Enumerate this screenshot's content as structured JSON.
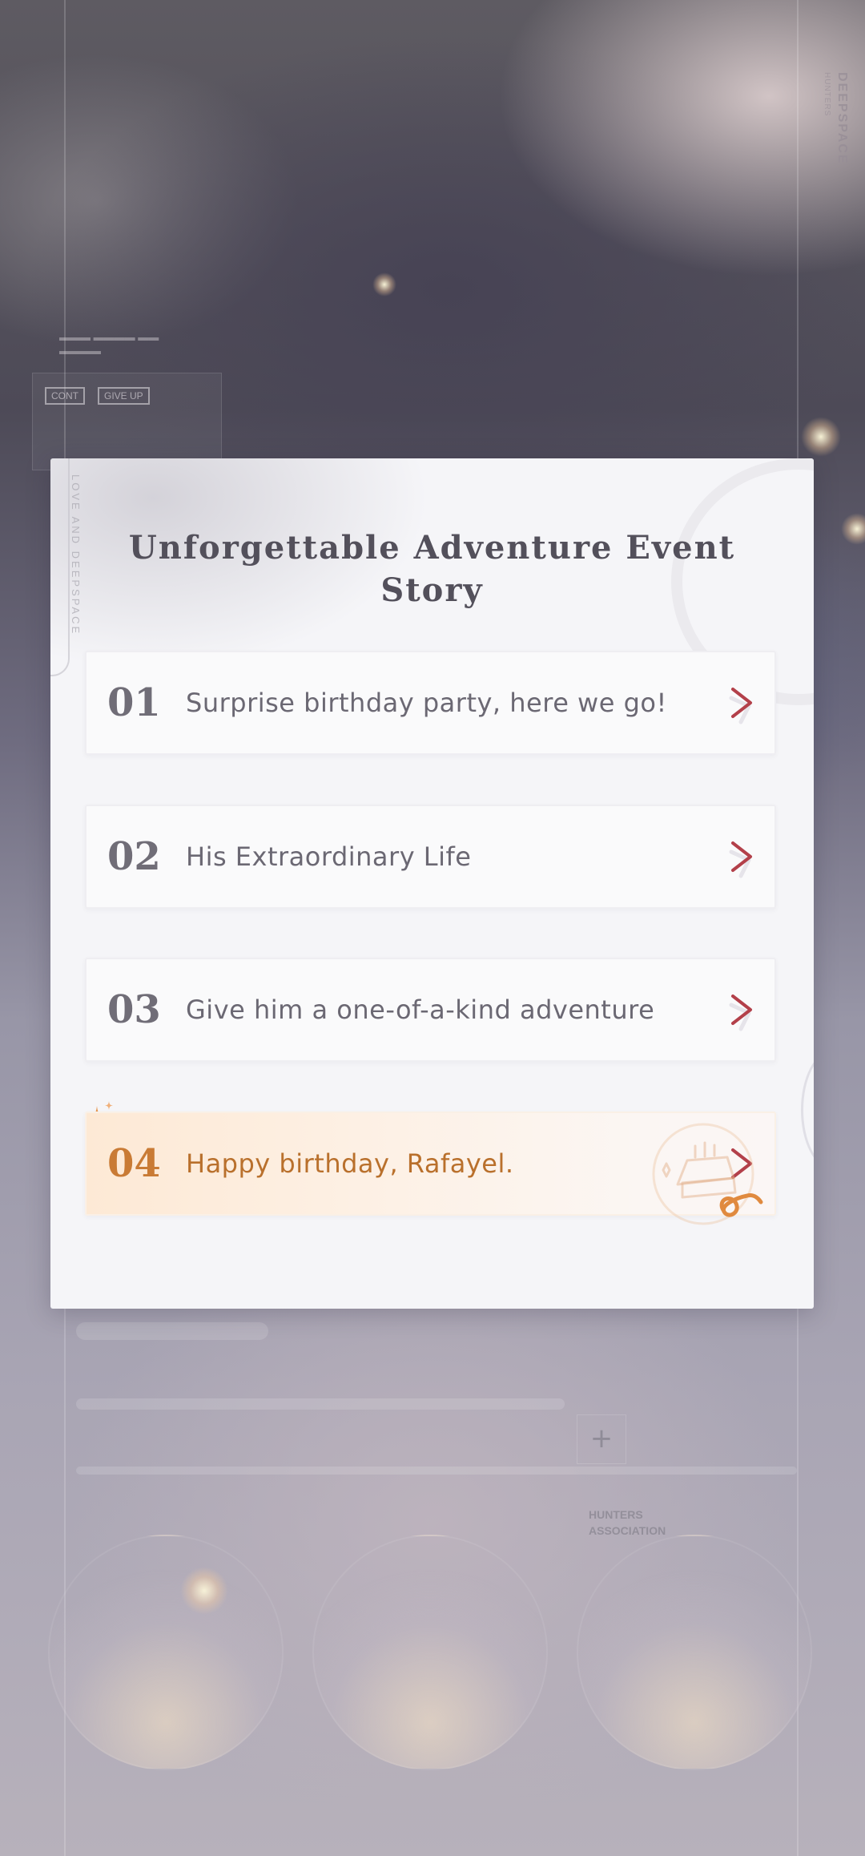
{
  "background": {
    "brand_vertical": "DEEPSPACE",
    "brand_sub": "HUNTERS",
    "ghost_buttons": [
      "CONT",
      "GIVE UP"
    ],
    "association": "HUNTERS\nASSOCIATION"
  },
  "modal": {
    "side_tag": "LOVE AND DEEPSPACE",
    "title": "Unforgettable Adventure Event Story",
    "episodes": [
      {
        "number": "01",
        "label": "Surprise birthday party, here we go!",
        "style": "normal"
      },
      {
        "number": "02",
        "label": "His Extraordinary Life",
        "style": "normal"
      },
      {
        "number": "03",
        "label": "Give him a one-of-a-kind adventure",
        "style": "normal"
      },
      {
        "number": "04",
        "label": "Happy birthday, Rafayel.",
        "style": "special"
      }
    ]
  },
  "colors": {
    "chevron": "#b3404a",
    "special_accent": "#c97b35",
    "modal_bg": "#f5f5f8"
  },
  "icons": {
    "chevron": "chevron-right-icon",
    "sparkle": "sparkle-icon",
    "emblem": "birthday-cake-icon"
  }
}
